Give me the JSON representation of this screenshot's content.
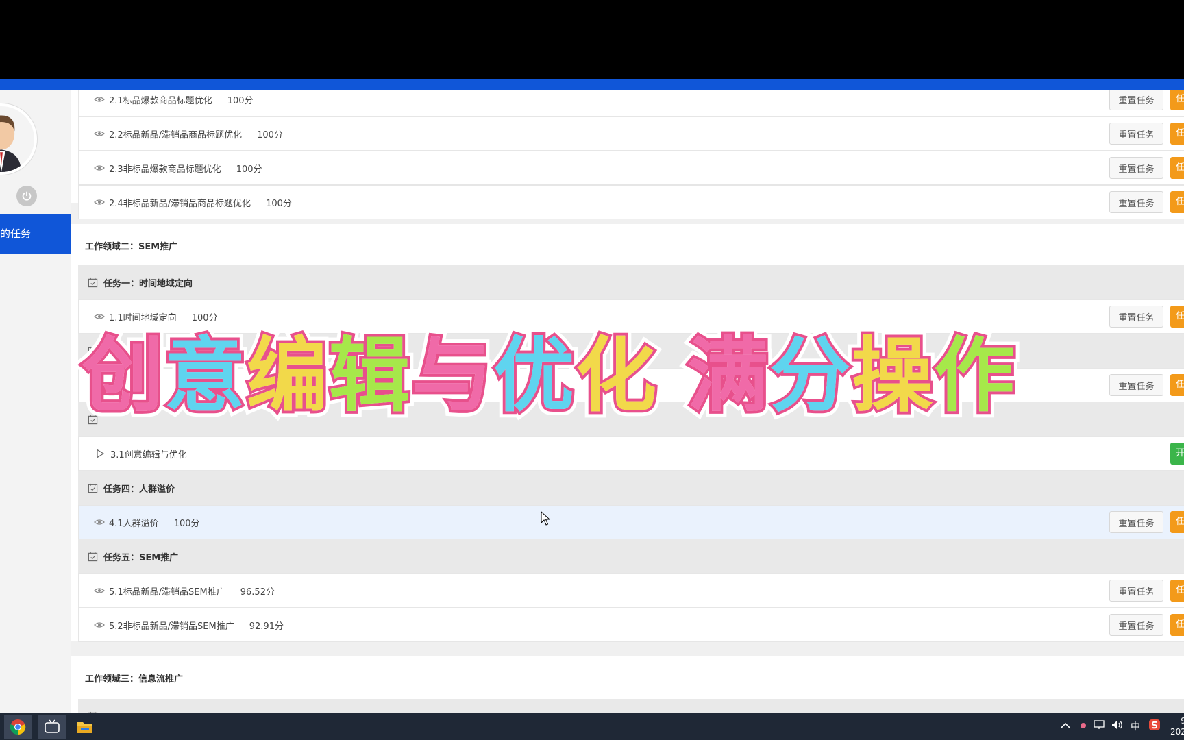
{
  "sidebar": {
    "active_nav": "的任务"
  },
  "areas": {
    "area1_rows": [
      {
        "name": "2.1标品爆款商品标题优化",
        "score": "100分"
      },
      {
        "name": "2.2标品新品/滞销品商品标题优化",
        "score": "100分"
      },
      {
        "name": "2.3非标品爆款商品标题优化",
        "score": "100分"
      },
      {
        "name": "2.4非标品新品/滞销品商品标题优化",
        "score": "100分"
      }
    ],
    "area2": {
      "title": "工作领域二：SEM推广",
      "task1_title": "任务一：时间地域定向",
      "task1_row": {
        "name": "1.1时间地域定向",
        "score": "100分"
      },
      "task3_row": {
        "name": "3.1创意编辑与优化"
      },
      "task4_title": "任务四：人群溢价",
      "task4_row": {
        "name": "4.1人群溢价",
        "score": "100分"
      },
      "task5_title": "任务五：SEM推广",
      "task5_rows": [
        {
          "name": "5.1标品新品/滞销品SEM推广",
          "score": "96.52分"
        },
        {
          "name": "5.2非标品新品/滞销品SEM推广",
          "score": "92.91分"
        }
      ]
    },
    "area3": {
      "title": "工作领域三：信息流推广"
    }
  },
  "buttons": {
    "reset_label": "重置任务",
    "orange_label": "任",
    "green_label": "开"
  },
  "overlay": {
    "chars": [
      "创",
      "意",
      "编",
      "辑",
      "与",
      "优",
      "化",
      " ",
      "满",
      "分",
      "操",
      "作"
    ],
    "colors": [
      "#f06aa8",
      "#5fd4ef",
      "#f2d94a",
      "#a6e84a",
      "#f06aa8",
      "#5fd4ef",
      "#f2d94a",
      "#ffffff",
      "#f06aa8",
      "#5fd4ef",
      "#f2d94a",
      "#a6e84a"
    ]
  },
  "taskbar": {
    "ime": "中",
    "clock_partial": "9",
    "year_partial": "202"
  },
  "colors": {
    "primary_blue": "#1056d8",
    "orange": "#f39a1a",
    "green": "#3bb54a"
  }
}
